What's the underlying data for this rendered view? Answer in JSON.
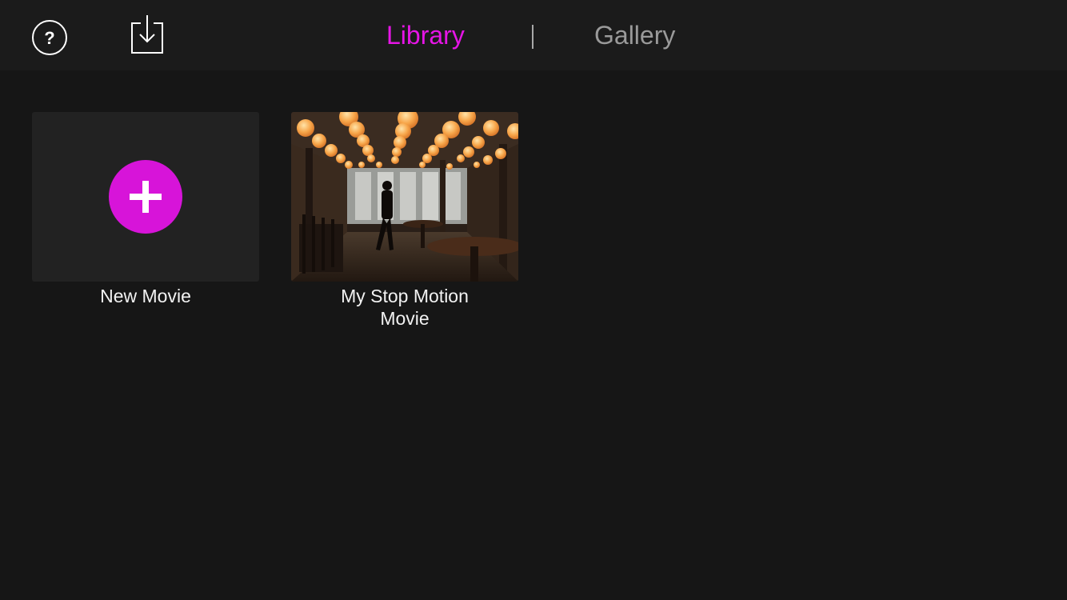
{
  "topbar": {
    "help_icon": "question-circle-icon",
    "import_icon": "download-tray-icon",
    "tabs": [
      {
        "label": "Library",
        "active": true,
        "color": "#e615e6"
      },
      {
        "label": "Gallery",
        "active": false,
        "color": "#9a9a9a"
      }
    ],
    "divider": "|"
  },
  "library": {
    "new_movie": {
      "label": "New Movie",
      "icon": "plus-icon",
      "accent": "#d714d9"
    },
    "movies": [
      {
        "title": "My Stop Motion Movie",
        "thumbnail": "restaurant-interior-with-paper-lanterns"
      }
    ]
  }
}
